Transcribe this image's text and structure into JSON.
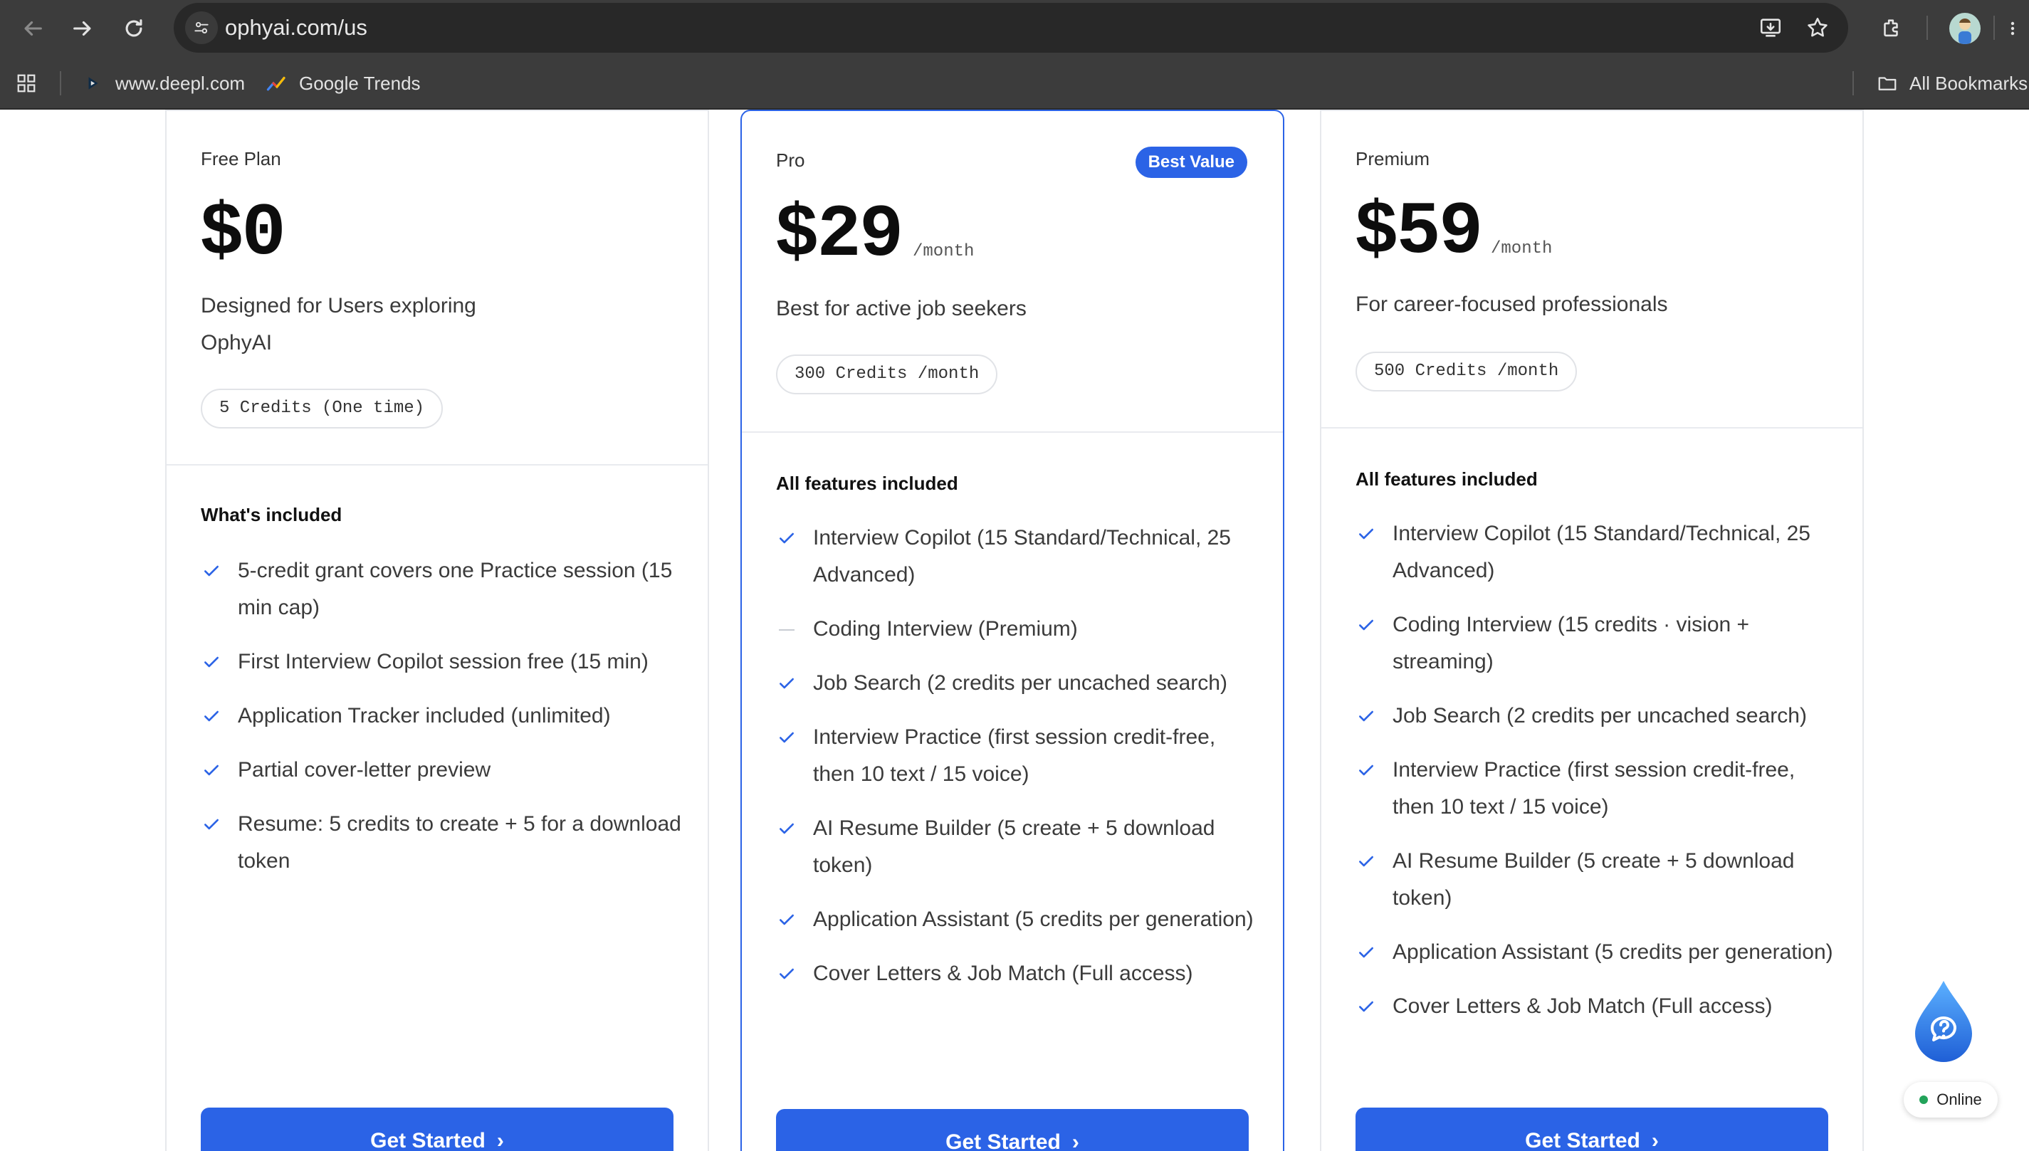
{
  "browser": {
    "url": "ophyai.com/us",
    "bookmarks": [
      {
        "label": "www.deepl.com",
        "icon": "deepl-icon"
      },
      {
        "label": "Google Trends",
        "icon": "google-trends-icon"
      }
    ],
    "all_bookmarks_label": "All Bookmarks"
  },
  "plans": {
    "free": {
      "name": "Free Plan",
      "price": "$0",
      "description_line1": "Designed for Users exploring",
      "description_line2": "OphyAI",
      "credits": "5 Credits (One time)",
      "section_title": "What's included",
      "features": [
        "5-credit grant covers one Practice session (15 min cap)",
        "First Interview Copilot session free (15 min)",
        "Application Tracker included (unlimited)",
        "Partial cover-letter preview",
        "Resume: 5 credits to create + 5 for a download token"
      ],
      "cta": "Get Started"
    },
    "pro": {
      "name": "Pro",
      "badge": "Best Value",
      "price": "$29",
      "per": "/month",
      "description": "Best for active job seekers",
      "credits": "300 Credits /month",
      "section_title": "All features included",
      "features": [
        "Interview Copilot (15 Standard/Technical, 25 Advanced)",
        "Coding Interview (Premium)",
        "Job Search (2 credits per uncached search)",
        "Interview Practice (first session credit-free, then 10 text / 15 voice)",
        "AI Resume Builder (5 create + 5 download token)",
        "Application Assistant (5 credits per generation)",
        "Cover Letters & Job Match (Full access)"
      ],
      "cta": "Get Started"
    },
    "premium": {
      "name": "Premium",
      "price": "$59",
      "per": "/month",
      "description": "For career-focused professionals",
      "credits": "500 Credits /month",
      "section_title": "All features included",
      "features": [
        "Interview Copilot (15 Standard/Technical, 25 Advanced)",
        "Coding Interview (15 credits · vision + streaming)",
        "Job Search (2 credits per uncached search)",
        "Interview Practice (first session credit-free, then 10 text / 15 voice)",
        "AI Resume Builder (5 create + 5 download token)",
        "Application Assistant (5 credits per generation)",
        "Cover Letters & Job Match (Full access)"
      ],
      "cta": "Get Started"
    }
  },
  "chat_widget": {
    "status": "Online"
  },
  "colors": {
    "accent": "#2b63e6",
    "check": "#2b63e6",
    "online_dot": "#22a35a"
  }
}
